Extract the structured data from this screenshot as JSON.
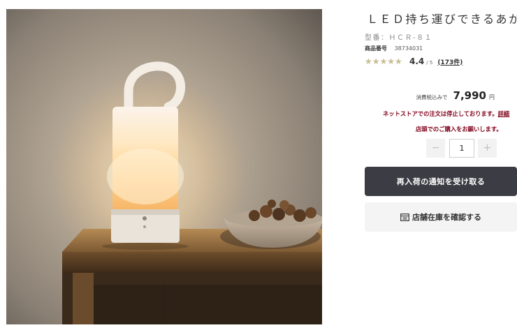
{
  "product": {
    "title": "ＬＥＤ持ち運びできるあかり",
    "model": "型番：ＨＣＲ-８１",
    "product_number_label": "商品番号",
    "product_number": "38734031"
  },
  "rating": {
    "stars_glyphs": "★★★★★",
    "value": 4.4,
    "score_text": "4.4",
    "scale_text": "/ 5",
    "reviews_text": "(173件)"
  },
  "price": {
    "tax_label": "消費税込みで",
    "amount": "7,990",
    "currency": "円"
  },
  "notices": {
    "line1": "ネットストアでの注文は停止しております。",
    "detail_link": "詳細",
    "line2": "店頭でのご購入をお願いします。"
  },
  "quantity": {
    "minus": "−",
    "value": "1",
    "plus": "+"
  },
  "buttons": {
    "notify_label": "再入荷の通知を受け取る",
    "store_label": "店舗在庫を確認する"
  },
  "colors": {
    "notice": "#7f0019",
    "primary_button": "#3c3c44",
    "secondary_button": "#f4f4f4",
    "star_filled": "#c9bd93",
    "star_empty": "#e6e2d6"
  },
  "icons": {
    "store": "store-icon",
    "star": "star-icon"
  }
}
